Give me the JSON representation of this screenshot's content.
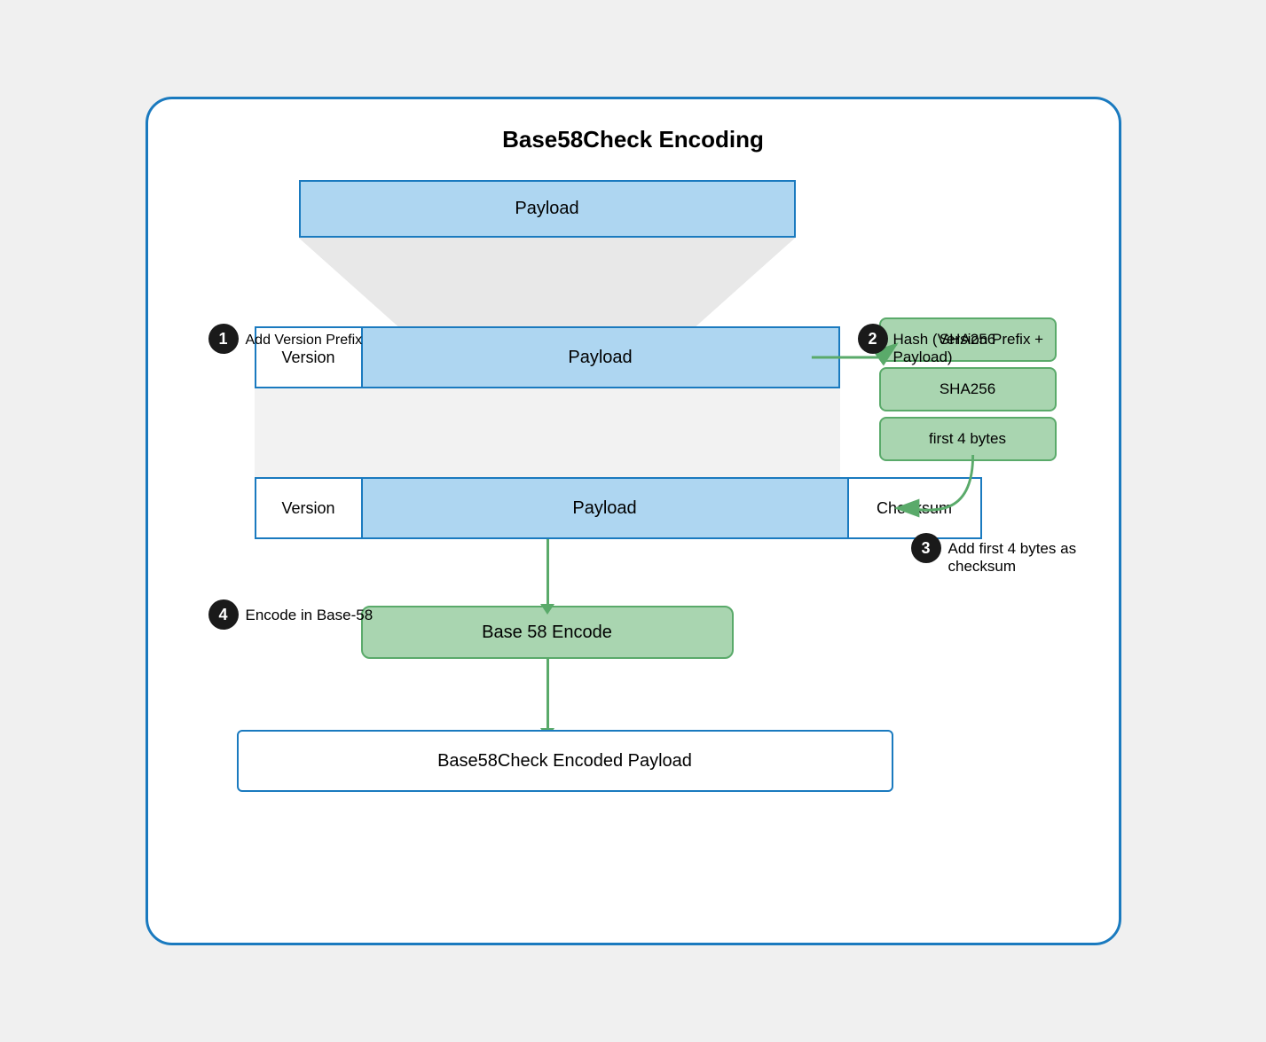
{
  "title": "Base58Check Encoding",
  "steps": [
    {
      "number": "1",
      "label": "Add Version Prefix"
    },
    {
      "number": "2",
      "label": "Hash (Version Prefix + Payload)"
    },
    {
      "number": "3",
      "label": "Add first 4 bytes as checksum"
    },
    {
      "number": "4",
      "label": "Encode in Base-58"
    }
  ],
  "boxes": {
    "payload_top": "Payload",
    "version1": "Version",
    "payload_mid": "Payload",
    "version2": "Version",
    "payload_bot": "Payload",
    "checksum": "Checksum",
    "sha1": "SHA256",
    "sha2": "SHA256",
    "first4bytes": "first 4 bytes",
    "base58encode": "Base 58 Encode",
    "final": "Base58Check Encoded Payload"
  },
  "colors": {
    "blue_border": "#1a7abf",
    "blue_fill": "#aed6f1",
    "green_fill": "#a9d5b0",
    "green_border": "#5aaa6a",
    "dark": "#1a1a1a",
    "white": "#ffffff",
    "gray": "#e8e8e8"
  }
}
